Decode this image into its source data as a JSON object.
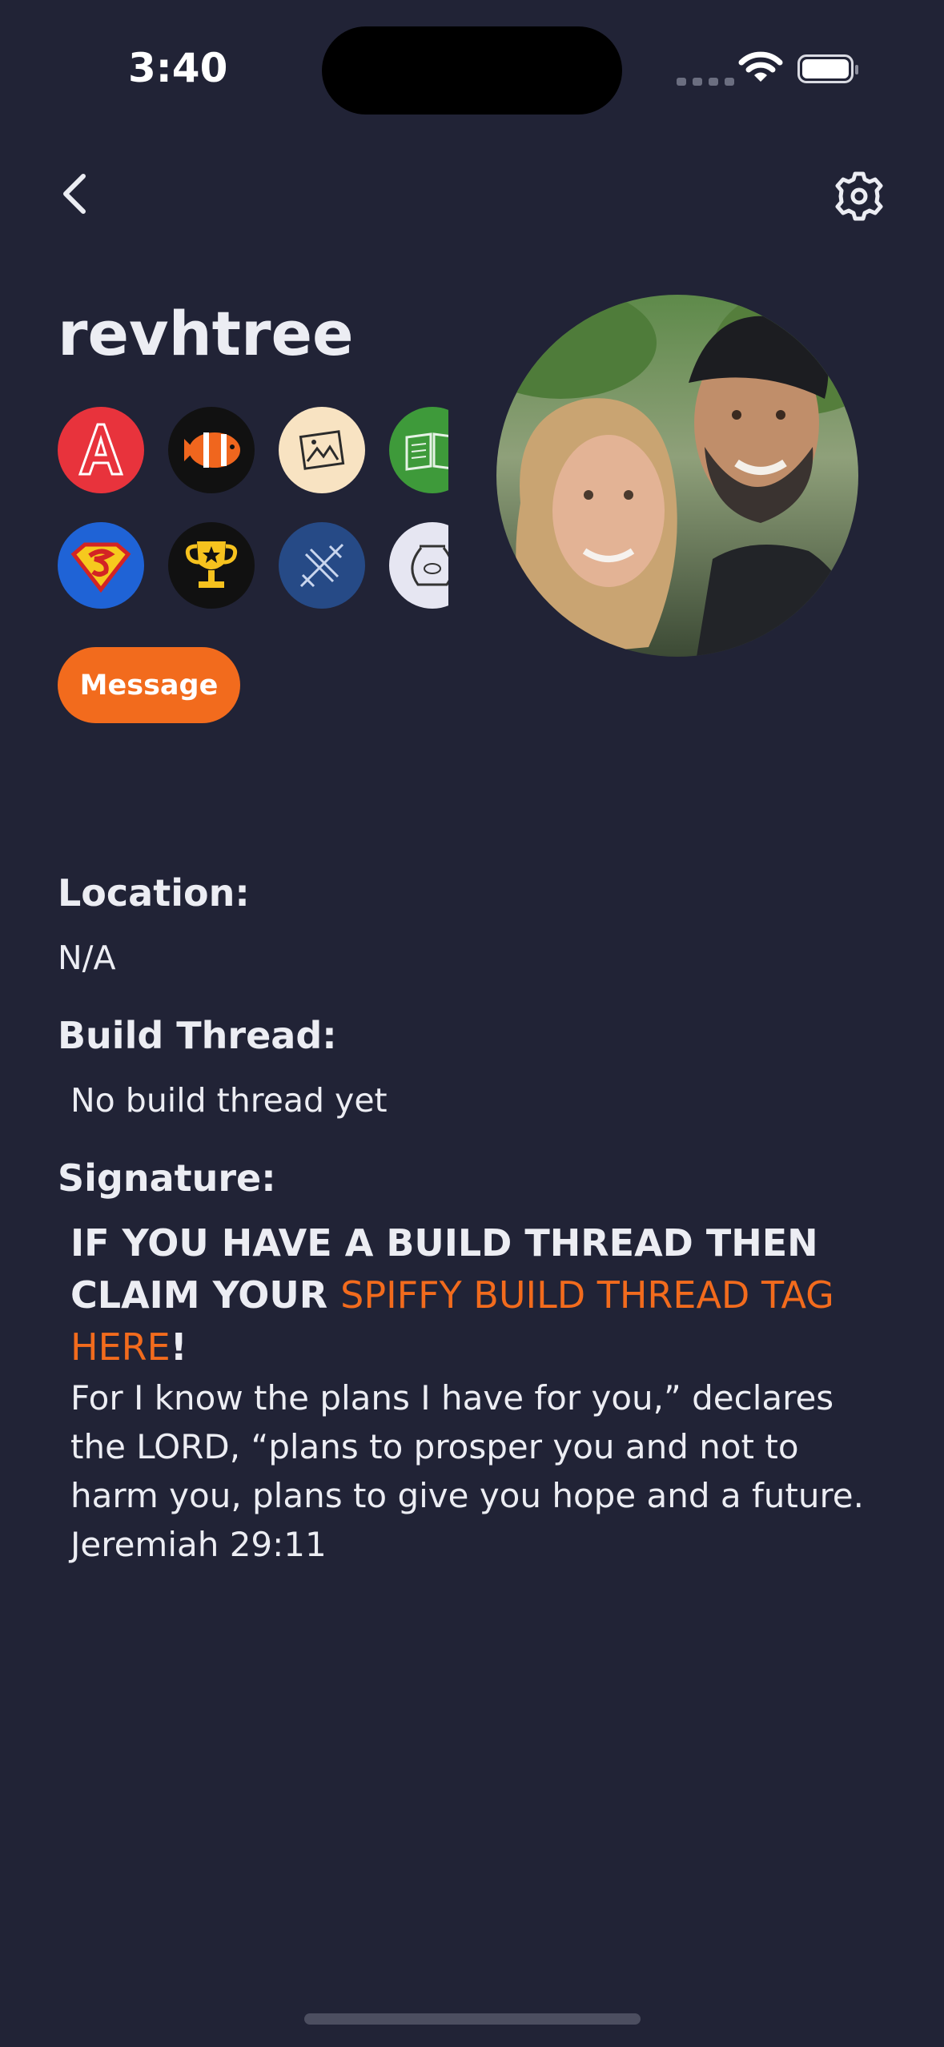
{
  "status_bar": {
    "time": "3:40"
  },
  "profile": {
    "username": "revhtree",
    "message_label": "Message",
    "badges": [
      {
        "icon": "letter-a-badge-icon",
        "color": "#E8333C"
      },
      {
        "icon": "clownfish-badge-icon",
        "color": "#111111"
      },
      {
        "icon": "picture-frame-badge-icon",
        "color": "#F8E3C2"
      },
      {
        "icon": "book-badge-icon",
        "color": "#3E9A3A"
      },
      {
        "icon": "superman-badge-icon",
        "color": "#1F63D6"
      },
      {
        "icon": "trophy-badge-icon",
        "color": "#111111"
      },
      {
        "icon": "x-wing-badge-icon",
        "color": "#264A86"
      },
      {
        "icon": "fishbowl-badge-icon",
        "color": "#E6E6F2"
      }
    ]
  },
  "details": {
    "location_label": "Location:",
    "location_value": "N/A",
    "build_thread_label": "Build Thread:",
    "build_thread_value": "No build thread yet",
    "signature_label": "Signature:",
    "signature": {
      "bold_prefix": "IF YOU HAVE A BUILD THREAD THEN CLAIM YOUR ",
      "link_text": "SPIFFY BUILD THREAD TAG HERE",
      "bold_suffix": "!",
      "body": "For I know the plans I have for you,” declares the LORD, “plans to prosper you and not to harm you, plans to give you hope and a future. Jeremiah 29:11"
    }
  },
  "colors": {
    "background": "#212336",
    "accent": "#F26B1D",
    "text": "#ECEDF3"
  }
}
